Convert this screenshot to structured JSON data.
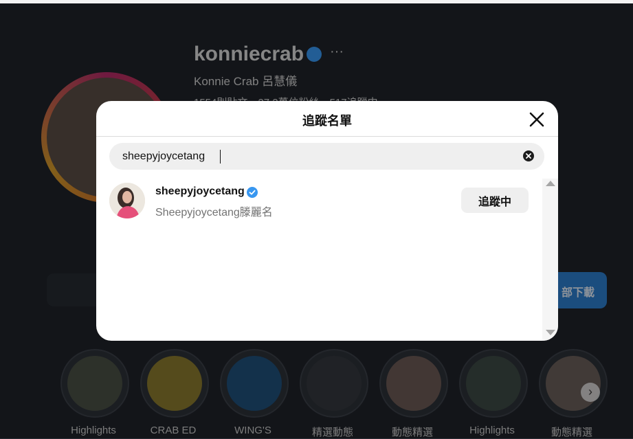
{
  "modal": {
    "title": "追蹤名單",
    "search": {
      "value": "sheepyjoycetang"
    },
    "results": [
      {
        "username": "sheepyjoycetang",
        "verified": true,
        "full_name": "Sheepyjoycetang滕麗名",
        "button_label": "追蹤中"
      }
    ]
  },
  "background_profile": {
    "username": "konniecrab",
    "full_name": "Konnie Crab 呂慧儀",
    "stats_text": "1554則貼文　27.2萬位粉絲　517追蹤中",
    "download_label": "部下載",
    "highlights": [
      "Highlights",
      "CRAB ED",
      "WING'S",
      "精選動態",
      "動態精選",
      "Highlights",
      "動態精選"
    ]
  },
  "colors": {
    "accent": "#3897f0",
    "button_bg": "#efefef",
    "secondary_text": "#737373"
  }
}
